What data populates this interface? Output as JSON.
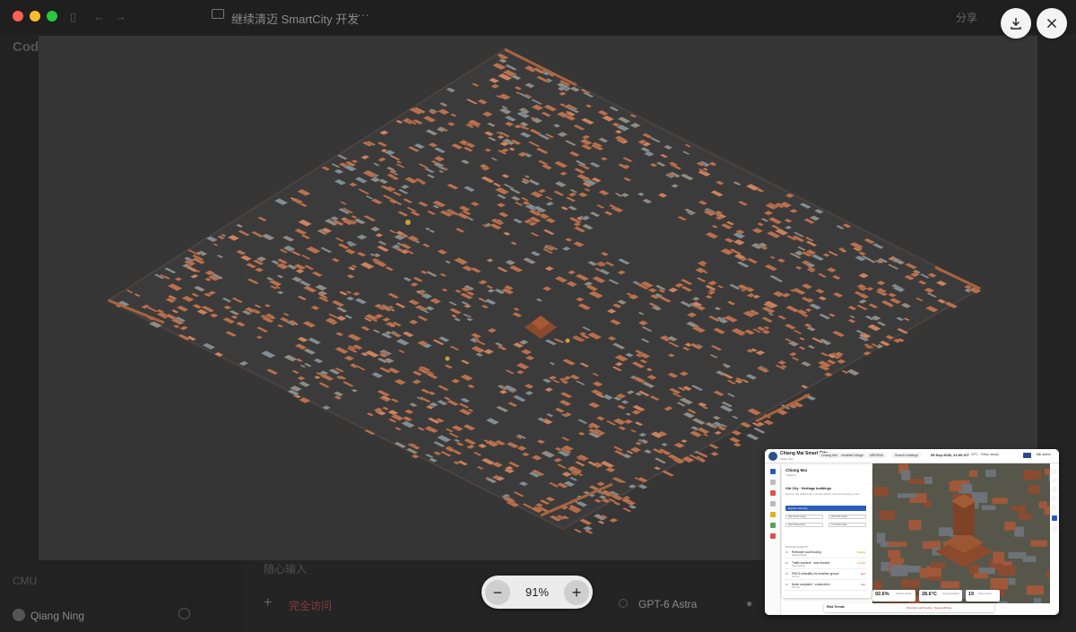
{
  "window": {
    "title": "继续清迈 SmartCity 开发",
    "share_label": "分享"
  },
  "sidebar": {
    "app_name": "Code",
    "project_footer": "CMU",
    "user_name": "Qiang Ning"
  },
  "composer": {
    "placeholder": "随心输入",
    "access_label": "完全访问",
    "model_label": "GPT-6 Astra"
  },
  "viewer": {
    "zoom_level": "91%",
    "zoom_out_symbol": "−",
    "zoom_in_symbol": "+"
  },
  "thumbnail": {
    "app_title": "Chiang Mai Smart City",
    "app_subtitle": "Urban Ops",
    "chips": [
      "Chiang Mai",
      "Inhabitat Village",
      "MEERNA"
    ],
    "search_label": "Search buildings",
    "datetime": "09 Sep 2026, 21:00 ICT",
    "weather": "29°C · Partly cloudy",
    "talk_label": "Talk admin",
    "panel": {
      "city": "Chiang Mai",
      "city_sub": "Thailand",
      "section_title": "Old City · Heritage buildings",
      "section_desc": "Explore the walled city's temple district and surrounding zones",
      "primary_button": "Explore Old City",
      "selects": [
        "Wat Chedi Luang",
        "Wat Phra Singh",
        "Wat Chiang Man",
        "Tha Phae Gate"
      ],
      "events_header": "RANKED EVENTS",
      "events": [
        {
          "tag": "#1",
          "title": "Riverside road flooding",
          "sub": "Nawarat Bridge",
          "badge": "Pending"
        },
        {
          "tag": "#2",
          "title": "Traffic accident · lane blocked",
          "sub": "Superhighway",
          "badge": "Pending"
        },
        {
          "tag": "#3",
          "title": "PM2.5 unhealthy for sensitive groups",
          "sub": "Old City",
          "badge": "Alert"
        },
        {
          "tag": "#4",
          "title": "Noise complaint · construction",
          "sub": "Nimman",
          "badge": "New"
        }
      ]
    },
    "stats": [
      {
        "value": "92.6%",
        "label": "Sensors online"
      },
      {
        "value": "28.6°C",
        "label": "Avg temperature"
      },
      {
        "value": "19",
        "label": "Open events"
      }
    ],
    "footer_title": "Risk Trends",
    "footer_alert": "Riverside road flooding · Nawarat Bridge"
  },
  "colors": {
    "roof_main": "#b8714f",
    "roof_light": "#c98362",
    "roof_grey": "#8d8d86",
    "roof_blue": "#7f8e96",
    "ground": "#3b3b3b",
    "accent_blue": "#2b5bbd"
  },
  "icons": {
    "download": "download-icon",
    "close": "close-icon"
  }
}
